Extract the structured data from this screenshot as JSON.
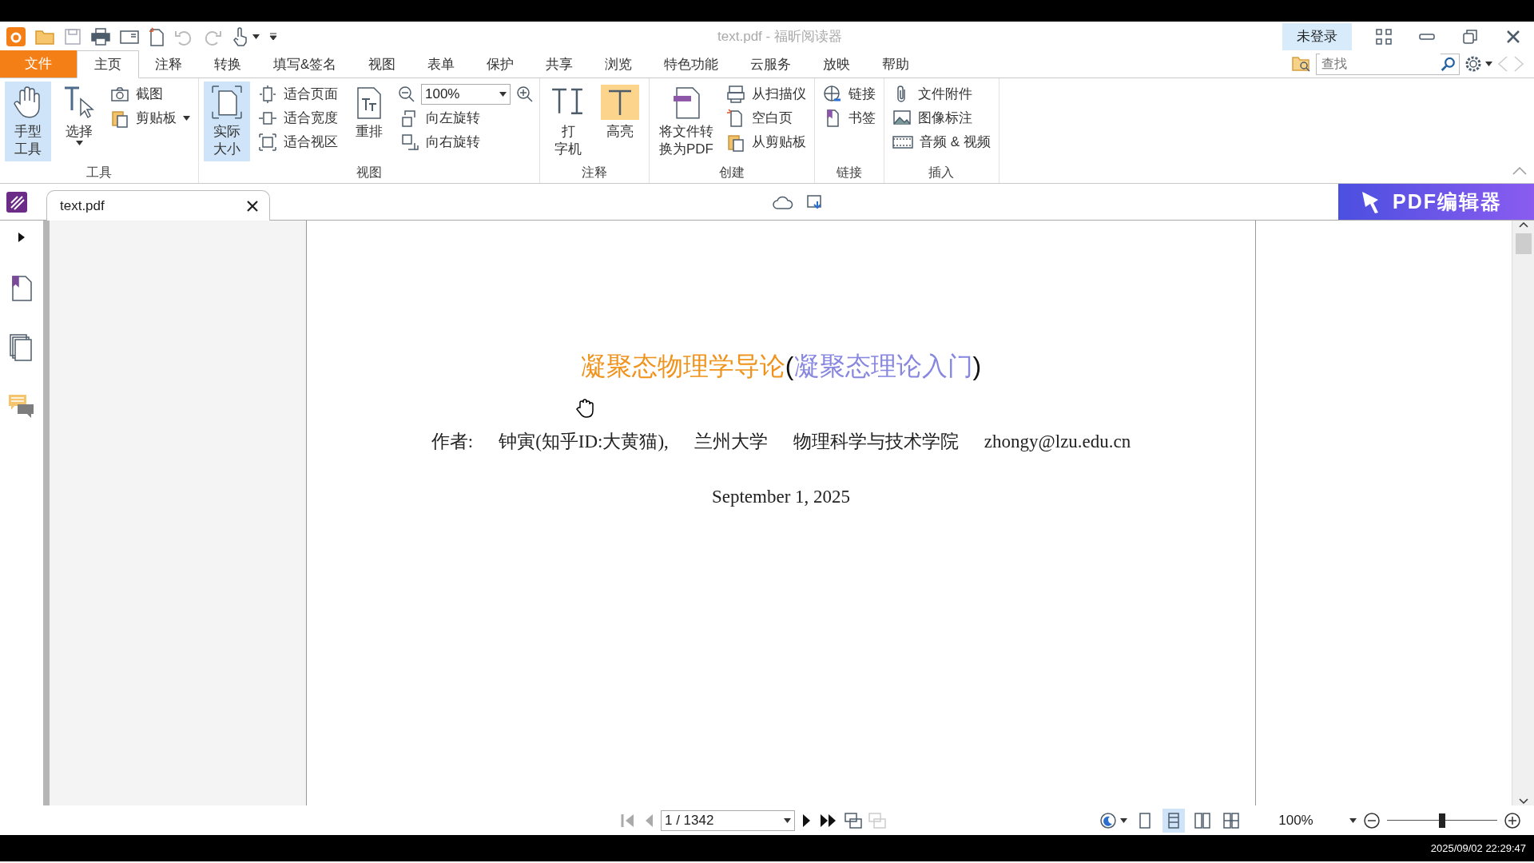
{
  "title_bar": {
    "title": "text.pdf - 福昕阅读器",
    "login_button": "未登录"
  },
  "menu_tabs": [
    {
      "label": "文件",
      "kind": "file",
      "selected": false
    },
    {
      "label": "主页",
      "kind": "tab",
      "selected": true
    },
    {
      "label": "注释",
      "kind": "tab",
      "selected": false
    },
    {
      "label": "转换",
      "kind": "tab",
      "selected": false
    },
    {
      "label": "填写&签名",
      "kind": "tab",
      "selected": false
    },
    {
      "label": "视图",
      "kind": "tab",
      "selected": false
    },
    {
      "label": "表单",
      "kind": "tab",
      "selected": false
    },
    {
      "label": "保护",
      "kind": "tab",
      "selected": false
    },
    {
      "label": "共享",
      "kind": "tab",
      "selected": false
    },
    {
      "label": "浏览",
      "kind": "tab",
      "selected": false
    },
    {
      "label": "特色功能",
      "kind": "tab",
      "selected": false
    },
    {
      "label": "云服务",
      "kind": "tab",
      "selected": false
    },
    {
      "label": "放映",
      "kind": "tab",
      "selected": false
    },
    {
      "label": "帮助",
      "kind": "tab",
      "selected": false
    }
  ],
  "search": {
    "placeholder": "查找"
  },
  "ribbon_groups": [
    {
      "label": "工具",
      "columns": [
        {
          "kind": "large",
          "lines": [
            "手型",
            "工具"
          ],
          "selected": true,
          "dropdown": false
        },
        {
          "kind": "large",
          "lines": [
            "选择"
          ],
          "selected": false,
          "dropdown": true
        },
        {
          "kind": "stack",
          "items": [
            {
              "kind": "button",
              "label": "截图",
              "dropdown": false
            },
            {
              "kind": "button",
              "label": "剪贴板",
              "dropdown": true
            }
          ]
        }
      ]
    },
    {
      "label": "视图",
      "columns": [
        {
          "kind": "large",
          "lines": [
            "实际",
            "大小"
          ],
          "selected": true,
          "dropdown": false
        },
        {
          "kind": "stack",
          "items": [
            {
              "kind": "button",
              "label": "适合页面",
              "dropdown": false
            },
            {
              "kind": "button",
              "label": "适合宽度",
              "dropdown": false
            },
            {
              "kind": "button",
              "label": "适合视区",
              "dropdown": false
            }
          ]
        },
        {
          "kind": "large",
          "lines": [
            "重排"
          ],
          "selected": false,
          "dropdown": false
        },
        {
          "kind": "stack",
          "items": [
            {
              "kind": "zoom",
              "value": "100%"
            },
            {
              "kind": "button",
              "label": "向左旋转",
              "dropdown": false
            },
            {
              "kind": "button",
              "label": "向右旋转",
              "dropdown": false
            }
          ]
        }
      ]
    },
    {
      "label": "注释",
      "columns": [
        {
          "kind": "large",
          "lines": [
            "打",
            "字机"
          ],
          "selected": false,
          "dropdown": false
        },
        {
          "kind": "large",
          "lines": [
            "高亮"
          ],
          "selected": false,
          "dropdown": false
        }
      ]
    },
    {
      "label": "创建",
      "columns": [
        {
          "kind": "large",
          "lines": [
            "将文件转",
            "换为PDF"
          ],
          "selected": false,
          "dropdown": false
        },
        {
          "kind": "stack",
          "items": [
            {
              "kind": "button",
              "label": "从扫描仪",
              "dropdown": false
            },
            {
              "kind": "button",
              "label": "空白页",
              "dropdown": false
            },
            {
              "kind": "button",
              "label": "从剪贴板",
              "dropdown": false
            }
          ]
        }
      ]
    },
    {
      "label": "链接",
      "columns": [
        {
          "kind": "stack",
          "items": [
            {
              "kind": "button",
              "label": "链接",
              "dropdown": false
            },
            {
              "kind": "button",
              "label": "书签",
              "dropdown": false
            }
          ]
        }
      ]
    },
    {
      "label": "插入",
      "columns": [
        {
          "kind": "stack",
          "items": [
            {
              "kind": "button",
              "label": "文件附件",
              "dropdown": false
            },
            {
              "kind": "button",
              "label": "图像标注",
              "dropdown": false
            },
            {
              "kind": "button",
              "label": "音频 & 视频",
              "dropdown": false
            }
          ]
        }
      ]
    }
  ],
  "doc_tabs": [
    {
      "label": "text.pdf",
      "selected": true
    }
  ],
  "promo_button": "PDF编辑器",
  "document": {
    "title": [
      {
        "text": "凝聚态物理学导论",
        "color": "#f0931d"
      },
      {
        "text": "(",
        "color": "#111111"
      },
      {
        "text": "凝聚态理论入门",
        "color": "#8787e0"
      },
      {
        "text": ")",
        "color": "#111111"
      }
    ],
    "author_line": [
      "作者:",
      "钟寅(知乎ID:大黄猫),",
      "兰州大学",
      "物理科学与技术学院",
      "zhongy@lzu.edu.cn"
    ],
    "date": "September 1, 2025"
  },
  "status_bar": {
    "page_field": "1 / 1342",
    "view_modes": [
      {
        "selected": false
      },
      {
        "selected": true
      },
      {
        "selected": false
      },
      {
        "selected": false
      }
    ],
    "zoom_value": "100%",
    "zoom_slider": {
      "level": 0.5
    }
  },
  "timestamp": "2025/09/02 22:29:47"
}
